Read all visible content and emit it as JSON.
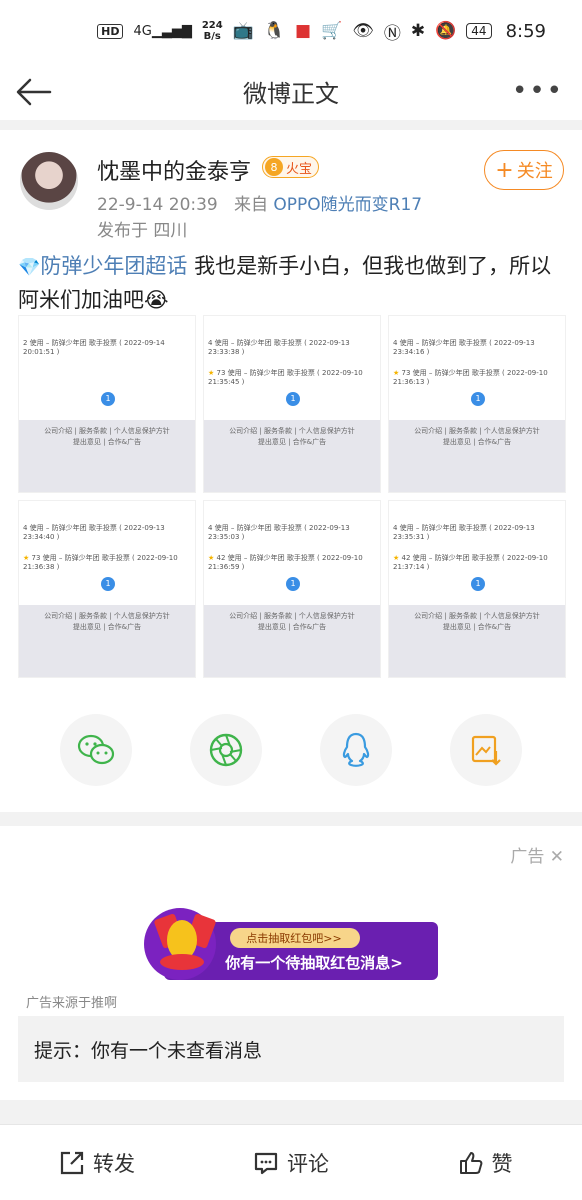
{
  "status_bar": {
    "hd_label": "HD",
    "signal_label": "4G",
    "net_speed_value": "224",
    "net_speed_unit": "B/s",
    "battery": "44",
    "time": "8:59"
  },
  "nav": {
    "title": "微博正文"
  },
  "post": {
    "username": "忱墨中的金泰亨",
    "badge_level": "8",
    "badge_label": "火宝",
    "follow_label": "关注",
    "timestamp": "22-9-14 20:39",
    "source_prefix": "来自",
    "source": "OPPO随光而变R17",
    "location": "发布于 四川",
    "topic": "防弹少年团超话",
    "text": " 我也是新手小白，但我也做到了，所以阿米们加油吧😭"
  },
  "images": [
    {
      "line1": "2 使用 – 防弹少年团 歌手投票 ( 2022-09-14 20:01:51 )",
      "line2": "",
      "dot": "1",
      "footer": "公司介绍 | 服务条款 | 个人信息保护方针\n提出意见 | 合作&广告"
    },
    {
      "line1": "4 使用 – 防弹少年团 歌手投票 ( 2022-09-13 23:33:38 )",
      "line2": "73 使用 – 防弹少年团 歌手投票 ( 2022-09-10 21:35:45 )",
      "dot": "1",
      "footer": "公司介绍 | 服务条款 | 个人信息保护方针\n提出意见 | 合作&广告"
    },
    {
      "line1": "4 使用 – 防弹少年团 歌手投票 ( 2022-09-13 23:34:16 )",
      "line2": "73 使用 – 防弹少年团 歌手投票 ( 2022-09-10 21:36:13 )",
      "dot": "1",
      "footer": "公司介绍 | 服务条款 | 个人信息保护方针\n提出意见 | 合作&广告"
    },
    {
      "line1": "4 使用 – 防弹少年团 歌手投票 ( 2022-09-13 23:34:40 )",
      "line2": "73 使用 – 防弹少年团 歌手投票 ( 2022-09-10 21:36:38 )",
      "dot": "1",
      "footer": "公司介绍 | 服务条款 | 个人信息保护方针\n提出意见 | 合作&广告"
    },
    {
      "line1": "4 使用 – 防弹少年团 歌手投票 ( 2022-09-13 23:35:03 )",
      "line2": "42 使用 – 防弹少年团 歌手投票 ( 2022-09-10 21:36:59 )",
      "dot": "1",
      "footer": "公司介绍 | 服务条款 | 个人信息保护方针\n提出意见 | 合作&广告"
    },
    {
      "line1": "4 使用 – 防弹少年团 歌手投票 ( 2022-09-13 23:35:31 )",
      "line2": "42 使用 – 防弹少年团 歌手投票 ( 2022-09-10 21:37:14 )",
      "dot": "1",
      "footer": "公司介绍 | 服务条款 | 个人信息保护方针\n提出意见 | 合作&广告"
    }
  ],
  "share": {
    "icons": [
      "wechat-icon",
      "moments-icon",
      "qq-icon",
      "save-image-icon"
    ]
  },
  "ad": {
    "label": "广告",
    "banner_top": "点击抽取红包吧>>",
    "banner_bottom": "你有一个待抽取红包消息>",
    "source": "广告来源于推啊",
    "notice": "提示：你有一个未查看消息"
  },
  "bottom_bar": {
    "repost": "转发",
    "comment": "评论",
    "like": "赞"
  },
  "colors": {
    "accent_orange": "#f58a24",
    "link_blue": "#4e7fb5",
    "wechat_green": "#3fb44b",
    "qq_blue": "#3a9be0",
    "save_orange": "#f0a020"
  }
}
